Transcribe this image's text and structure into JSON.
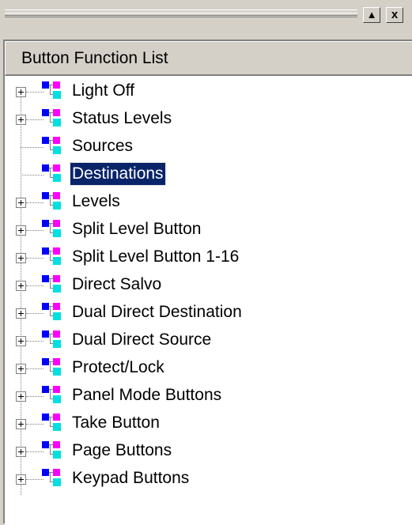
{
  "toolbar": {
    "scroll_up_symbol": "▲",
    "close_symbol": "x"
  },
  "panel": {
    "header_label": "Button Function List"
  },
  "tree": {
    "selected_index": 3,
    "items": [
      {
        "label": "Light Off",
        "expandable": true
      },
      {
        "label": "Status Levels",
        "expandable": true
      },
      {
        "label": "Sources",
        "expandable": false
      },
      {
        "label": "Destinations",
        "expandable": false
      },
      {
        "label": "Levels",
        "expandable": true
      },
      {
        "label": "Split Level Button",
        "expandable": true
      },
      {
        "label": "Split Level Button 1-16",
        "expandable": true
      },
      {
        "label": "Direct Salvo",
        "expandable": true
      },
      {
        "label": "Dual Direct Destination",
        "expandable": true
      },
      {
        "label": "Dual Direct Source",
        "expandable": true
      },
      {
        "label": "Protect/Lock",
        "expandable": true
      },
      {
        "label": "Panel Mode Buttons",
        "expandable": true
      },
      {
        "label": "Take Button",
        "expandable": true
      },
      {
        "label": "Page Buttons",
        "expandable": true
      },
      {
        "label": "Keypad Buttons",
        "expandable": true
      }
    ]
  }
}
